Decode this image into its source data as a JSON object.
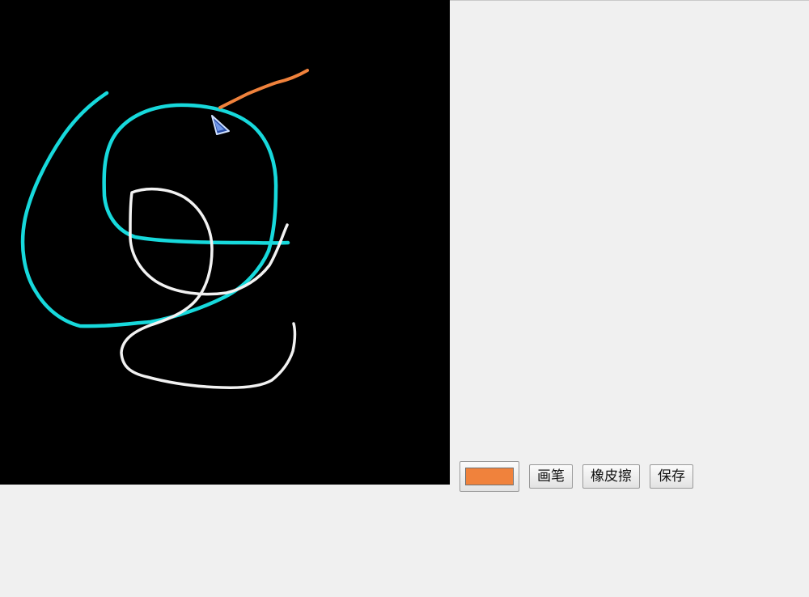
{
  "toolbar": {
    "color_hex": "#f0823c",
    "pen_label": "画笔",
    "eraser_label": "橡皮擦",
    "save_label": "保存"
  },
  "canvas": {
    "background": "#000000",
    "colors": {
      "cyan": "#17d9dc",
      "white": "#f2f2f2",
      "orange": "#f0823c"
    }
  }
}
